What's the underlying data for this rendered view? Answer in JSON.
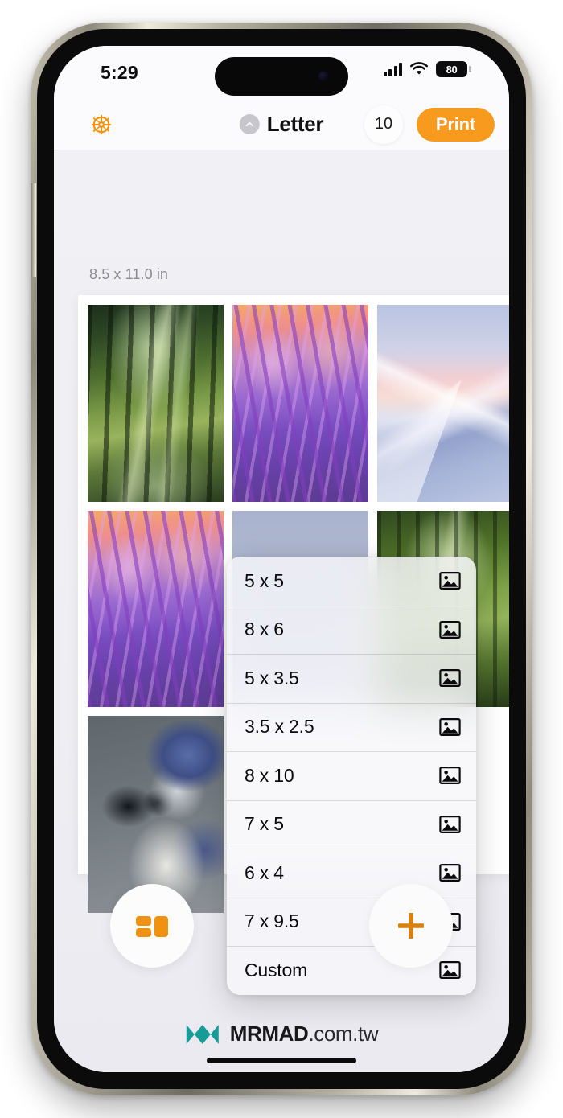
{
  "status_bar": {
    "time": "5:29",
    "battery_level": "80",
    "cellular_icon": "cellular-signal-icon",
    "wifi_icon": "wifi-icon",
    "battery_icon": "battery-icon"
  },
  "nav_bar": {
    "settings_icon": "gear-icon",
    "chevron_icon": "chevron-up-icon",
    "paper_size": "Letter",
    "copies": "10",
    "print_label": "Print",
    "print_color": "#F79A1E"
  },
  "content": {
    "paper_dimensions": "8.5 x 11.0 in",
    "photos": [
      {
        "name": "forest-path-photo",
        "style": "img-forest"
      },
      {
        "name": "lavender-field-photo",
        "style": "img-lavender"
      },
      {
        "name": "snowy-mountain-photo",
        "style": "img-mountain"
      },
      {
        "name": "lavender-field-photo-2",
        "style": "img-lavender"
      },
      {
        "name": "plain-gray-photo",
        "style": "img-plain"
      },
      {
        "name": "forest-canopy-photo",
        "style": "img-forest2"
      },
      {
        "name": "blue-jay-photo",
        "style": "img-bird"
      }
    ]
  },
  "size_menu": {
    "items": [
      {
        "label": "5 x 5",
        "icon": "image-icon"
      },
      {
        "label": "8 x 6",
        "icon": "image-icon"
      },
      {
        "label": "5 x 3.5",
        "icon": "image-icon"
      },
      {
        "label": "3.5 x 2.5",
        "icon": "image-icon"
      },
      {
        "label": "8 x 10",
        "icon": "image-icon"
      },
      {
        "label": "7 x 5",
        "icon": "image-icon"
      },
      {
        "label": "6 x 4",
        "icon": "image-icon"
      },
      {
        "label": "7 x 9.5",
        "icon": "image-icon"
      },
      {
        "label": "Custom",
        "icon": "image-icon"
      }
    ]
  },
  "toolbar": {
    "layout_icon": "layout-grid-icon",
    "add_icon": "plus-icon",
    "accent_color": "#F0920F"
  },
  "watermark": {
    "brand": "MRMAD",
    "domain": ".com.tw",
    "logo_color": "#179B96"
  }
}
